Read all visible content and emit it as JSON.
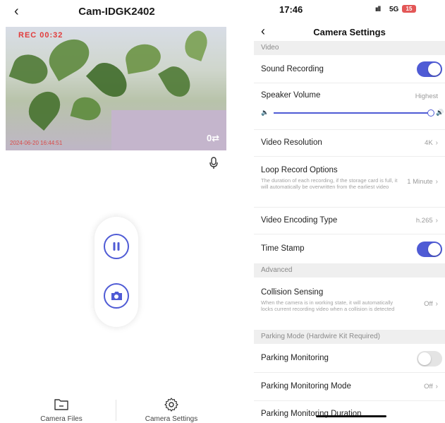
{
  "left": {
    "title": "Cam-IDGK2402",
    "back_glyph": "‹",
    "rec_label": "REC 00:32",
    "overlay_timestamp": "2024-06-20 16:44:51",
    "lens_label": "0⇄",
    "bottom_nav": [
      {
        "label": "Camera Files",
        "icon": "folder-icon"
      },
      {
        "label": "Camera Settings",
        "icon": "gear-icon"
      }
    ],
    "accent": "#4f5bd5"
  },
  "right": {
    "status": {
      "time": "17:46",
      "signal": "ııll",
      "network": "5G",
      "battery": "15"
    },
    "back_glyph": "‹",
    "title": "Camera Settings",
    "sections": {
      "video": "Video",
      "advanced": "Advanced",
      "parking": "Parking Mode (Hardwire Kit Required)"
    },
    "rows": {
      "sound_recording": {
        "label": "Sound Recording",
        "on": true
      },
      "speaker_volume": {
        "label": "Speaker Volume",
        "value": "Highest",
        "level": 1.0,
        "low_icon": "🔈",
        "high_icon": "🔊"
      },
      "video_resolution": {
        "label": "Video Resolution",
        "value": "4K"
      },
      "loop_record": {
        "label": "Loop Record Options",
        "desc": "The duration of each recording, if the storage card is full, it will automatically be overwritten from the earliest video",
        "value": "1 Minute"
      },
      "encoding": {
        "label": "Video Encoding Type",
        "value": "h.265"
      },
      "time_stamp": {
        "label": "Time Stamp",
        "on": true
      },
      "collision": {
        "label": "Collision Sensing",
        "desc": "When the camera is in working state, it will automatically locks current recording video when a collision is detected",
        "value": "Off"
      },
      "parking_monitoring": {
        "label": "Parking Monitoring",
        "on": false
      },
      "parking_mode": {
        "label": "Parking Monitoring Mode",
        "value": "Off"
      },
      "parking_duration": {
        "label": "Parking Monitoring Duration",
        "value": ""
      }
    },
    "chevron": "›",
    "toggle_on_color": "#4f5bd5"
  }
}
